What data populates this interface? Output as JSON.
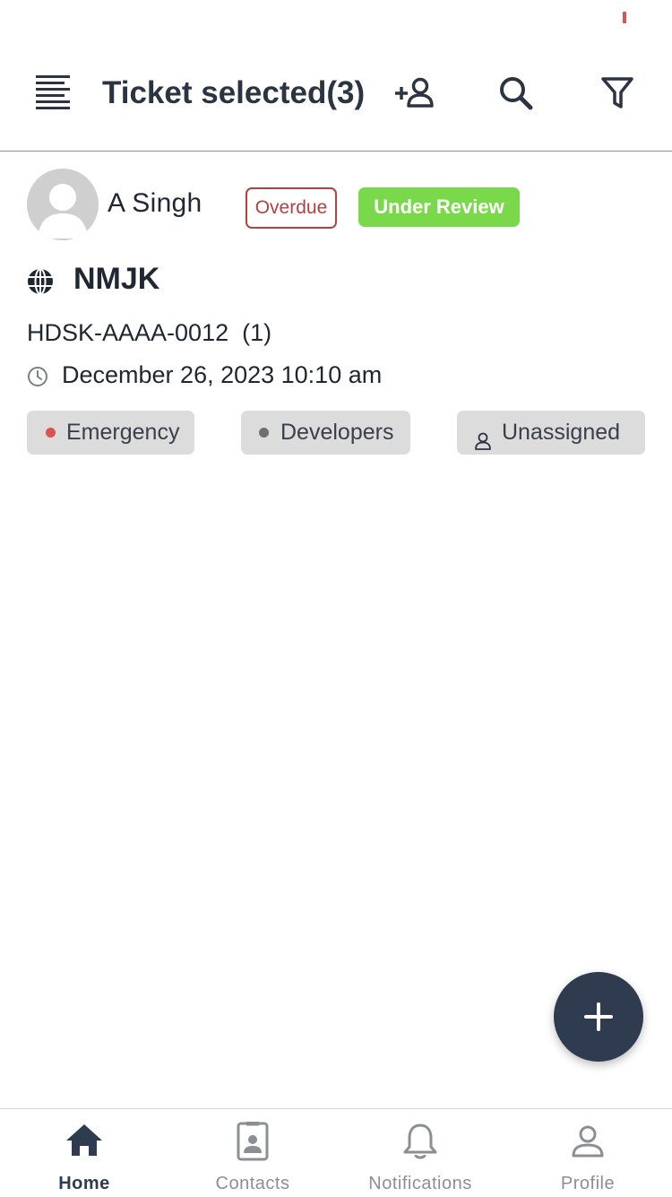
{
  "header": {
    "title": "Ticket selected",
    "count": "(3)"
  },
  "ticket": {
    "requester": "A Singh",
    "badge_overdue": "Overdue",
    "badge_status": "Under Review",
    "subject": "NMJK",
    "id": "HDSK-AAAA-0012  (1)",
    "date": "December 26, 2023 10:10 am",
    "chips": {
      "priority": "Emergency",
      "group": "Developers",
      "agent": "Unassigned"
    }
  },
  "colors": {
    "overdue": "#b4413f",
    "under_review": "#7ad94a",
    "emergency_dot": "#d9534f",
    "developers_dot": "#6f6f6f",
    "primary_dark": "#2f3b4e"
  },
  "icons": {
    "menu": "menu-lines-icon",
    "assign": "add-person-icon",
    "search": "search-icon",
    "filter": "filter-icon",
    "globe": "globe-icon",
    "clock": "clock-icon",
    "add": "plus-icon"
  },
  "nav": [
    {
      "label": "Home",
      "icon": "home-icon",
      "active": true
    },
    {
      "label": "Contacts",
      "icon": "contact-card-icon",
      "active": false
    },
    {
      "label": "Notifications",
      "icon": "bell-icon",
      "active": false
    },
    {
      "label": "Profile",
      "icon": "person-icon",
      "active": false
    }
  ]
}
